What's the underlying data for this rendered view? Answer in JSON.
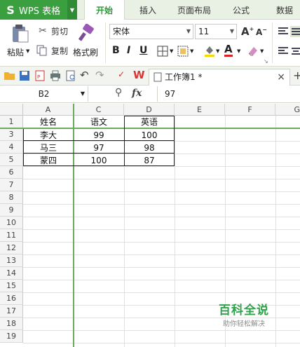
{
  "app": {
    "name": "WPS 表格"
  },
  "menu": {
    "tabs": [
      "开始",
      "插入",
      "页面布局",
      "公式",
      "数据"
    ]
  },
  "ribbon": {
    "paste_label": "粘贴",
    "cut_label": "剪切",
    "copy_label": "复制",
    "format_painter_label": "格式刷",
    "font_name": "宋体",
    "font_size": "11"
  },
  "document": {
    "tab_title": "工作簿1 *"
  },
  "formula_bar": {
    "cell_ref": "B2",
    "fx": "fx",
    "value": "97"
  },
  "sheet": {
    "columns": [
      "A",
      "C",
      "D",
      "E",
      "F",
      "G"
    ],
    "rows": [
      "1",
      "3",
      "4",
      "5",
      "6",
      "7",
      "8",
      "9",
      "10",
      "11",
      "12",
      "13",
      "14",
      "15",
      "16",
      "17",
      "18",
      "19"
    ],
    "table": [
      [
        "姓名",
        "语文",
        "英语"
      ],
      [
        "李大",
        "99",
        "100"
      ],
      [
        "马三",
        "97",
        "98"
      ],
      [
        "蒙四",
        "100",
        "87"
      ]
    ]
  },
  "watermark": {
    "title": "百科全说",
    "subtitle": "助你轻松解决"
  },
  "colors": {
    "accent": "#3a9f3f",
    "tab_active": "#2f9a3a"
  }
}
